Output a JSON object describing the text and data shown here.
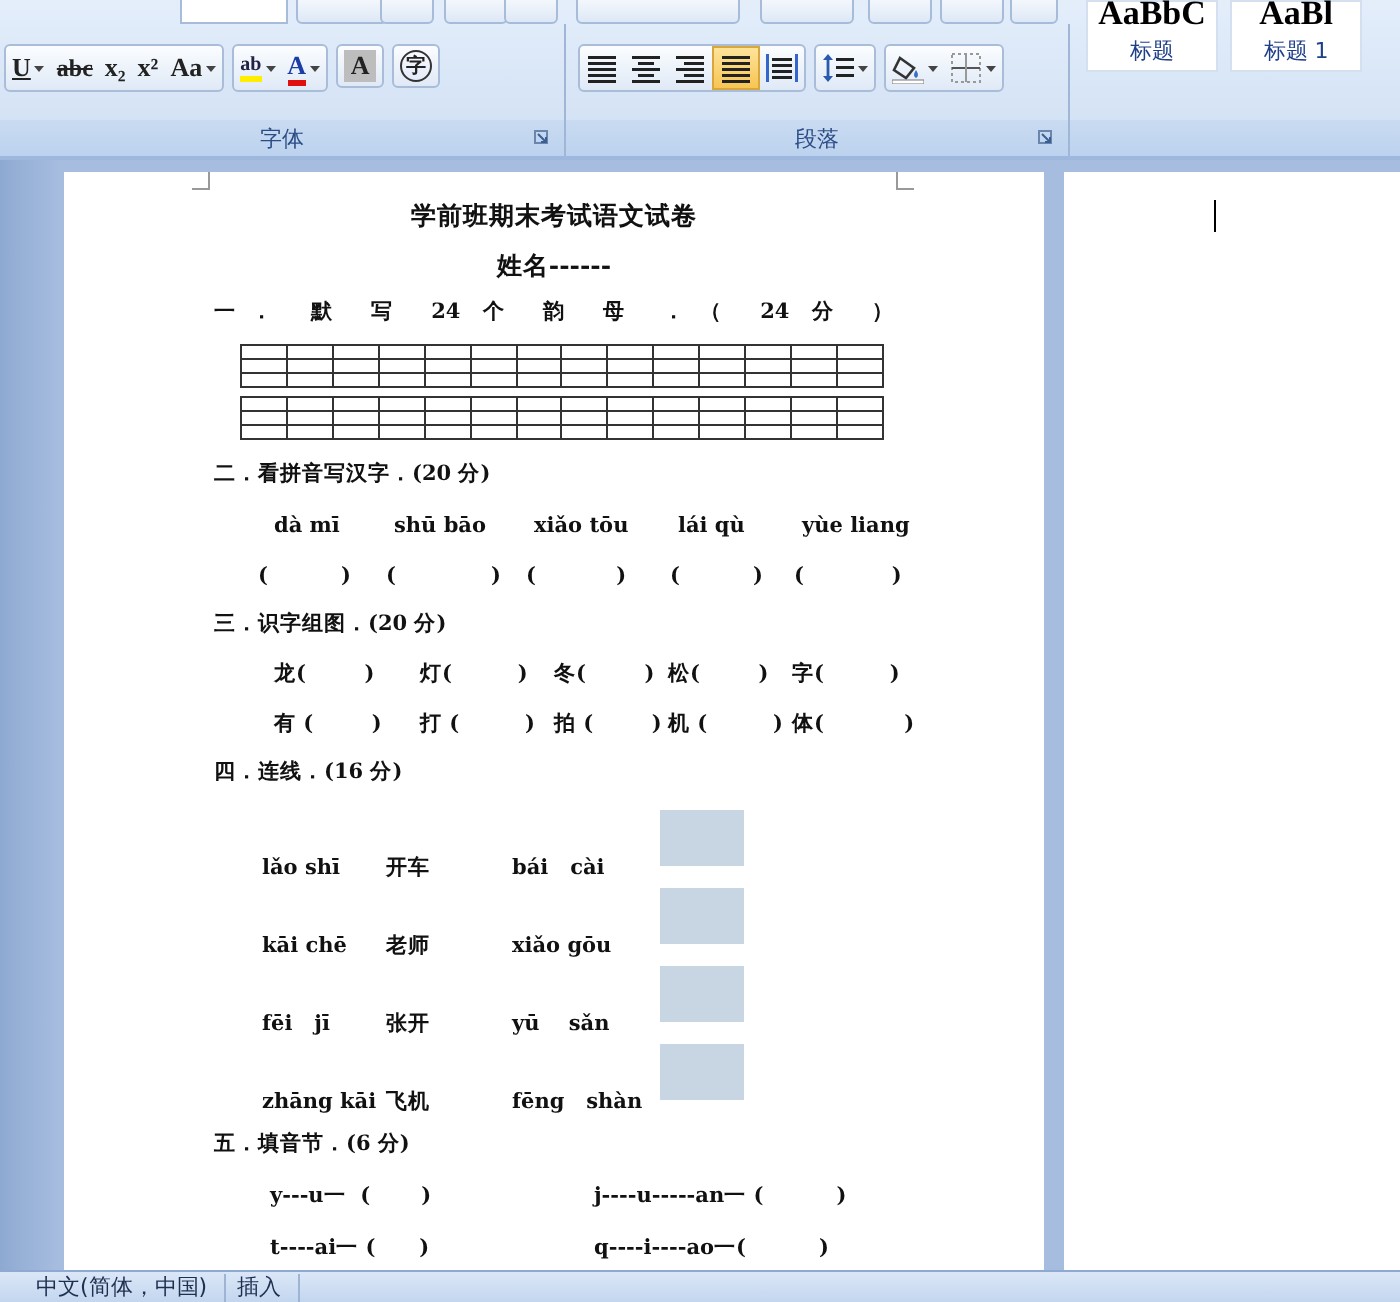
{
  "ribbon": {
    "groups": [
      {
        "label": "字体",
        "tools": [
          {
            "kind": "underline",
            "label": "U",
            "has_dropdown": true,
            "selected": false
          },
          {
            "kind": "strikethrough",
            "label": "abc",
            "has_dropdown": false,
            "selected": false
          },
          {
            "kind": "subscript",
            "label": "x₂",
            "has_dropdown": false,
            "selected": false
          },
          {
            "kind": "superscript",
            "label": "x²",
            "has_dropdown": false,
            "selected": false
          },
          {
            "kind": "change_case",
            "label": "Aa",
            "has_dropdown": true,
            "selected": false
          },
          {
            "kind": "highlight",
            "label": "ab",
            "has_dropdown": true,
            "selected": false
          },
          {
            "kind": "font_color",
            "label": "A",
            "has_dropdown": true,
            "selected": false
          },
          {
            "kind": "char_shading",
            "label": "A",
            "has_dropdown": false,
            "selected": false
          },
          {
            "kind": "enclose",
            "label": "字",
            "has_dropdown": false,
            "selected": false
          }
        ]
      },
      {
        "label": "段落",
        "tools": [
          {
            "kind": "align_left",
            "has_dropdown": false,
            "selected": false
          },
          {
            "kind": "align_center",
            "has_dropdown": false,
            "selected": false
          },
          {
            "kind": "align_right",
            "has_dropdown": false,
            "selected": false
          },
          {
            "kind": "justify",
            "has_dropdown": false,
            "selected": true
          },
          {
            "kind": "distributed",
            "has_dropdown": false,
            "selected": false
          },
          {
            "kind": "line_spacing",
            "has_dropdown": true,
            "selected": false
          },
          {
            "kind": "shading",
            "has_dropdown": true,
            "selected": false
          },
          {
            "kind": "borders",
            "has_dropdown": true,
            "selected": false
          }
        ]
      }
    ],
    "styles": [
      {
        "preview": "AaBbC",
        "label": "标题"
      },
      {
        "preview": "AaBl",
        "label": "标题 1"
      }
    ]
  },
  "document": {
    "title": "学前班期末考试语文试卷",
    "name_line": "姓名------",
    "sections": [
      {
        "kind": "grid",
        "heading": "一． 默 写 24 个 韵 母 ．（ 24 分 ）"
      },
      {
        "kind": "pinyin_brackets",
        "heading": "二．看拼音写汉字．(20 分)",
        "pinyin": [
          "dà mī",
          "shū bāo",
          "xiǎo tōu",
          "lái qù",
          "yùe liang"
        ],
        "brackets": [
          "(          )",
          "(             )",
          "(           )",
          "(          )",
          "(            )"
        ]
      },
      {
        "kind": "word_rows",
        "heading": "三．识字组图．(20 分)",
        "rows": [
          [
            "龙(        )",
            "灯(         )",
            "冬(        )",
            "松(        )",
            "字(         )"
          ],
          [
            "有 (        )",
            "打 (         )",
            "拍 (        )",
            "机 (         )",
            "体(           )"
          ]
        ]
      },
      {
        "kind": "matching",
        "heading": "四．连线．(16 分)",
        "rows": [
          {
            "pinyin_a": "lǎo shī",
            "hanzi": "开车",
            "pinyin_b": "bái   cài"
          },
          {
            "pinyin_a": "kāi chē",
            "hanzi": "老师",
            "pinyin_b": "xiǎo gōu"
          },
          {
            "pinyin_a": "fēi   jī",
            "hanzi": "张开",
            "pinyin_b": "yū    sǎn"
          },
          {
            "pinyin_a": "zhāng kāi",
            "hanzi": "飞机",
            "pinyin_b": "fēng   shàn"
          }
        ]
      },
      {
        "kind": "fill",
        "heading": "五．填音节．(6 分)",
        "rows": [
          [
            "y---u一  (       )",
            "j----u-----an一 (          )"
          ],
          [
            "t----ai一 (      )",
            "q----i----ao一(          )"
          ]
        ]
      }
    ]
  },
  "status_bar": {
    "items": [
      "中文(简体，中国)",
      "插入"
    ]
  }
}
